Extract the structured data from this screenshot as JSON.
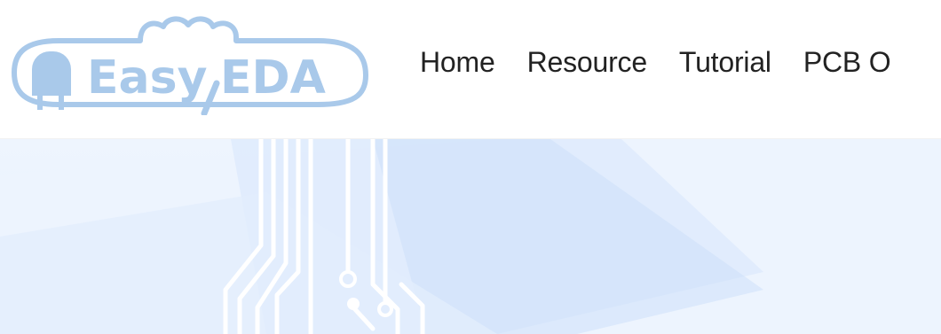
{
  "brand": {
    "name": "EasyEDA",
    "logo_text_left": "Easy",
    "logo_text_right": "EDA",
    "logo_color": "#a9c9ea"
  },
  "nav": {
    "items": [
      {
        "label": "Home"
      },
      {
        "label": "Resource"
      },
      {
        "label": "Tutorial"
      },
      {
        "label": "PCB O"
      }
    ]
  },
  "hero": {
    "background": "#e8f1fd",
    "accent": "#cfe2fb",
    "trace_color": "#ffffff"
  }
}
